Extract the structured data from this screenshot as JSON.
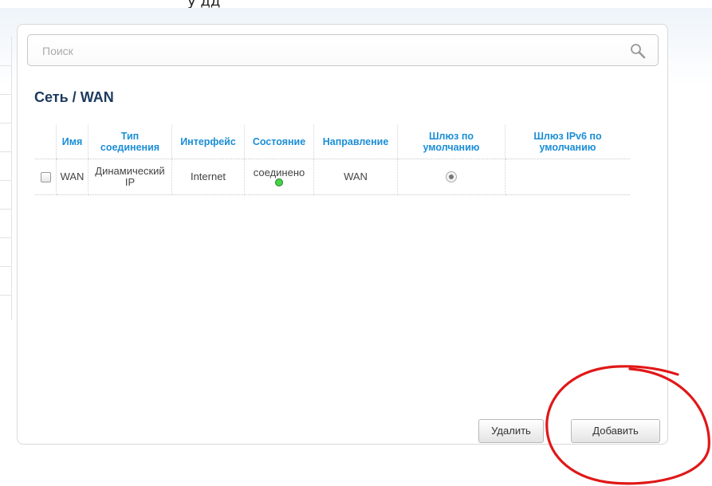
{
  "top_fragment": "у дд",
  "search": {
    "placeholder": "Поиск"
  },
  "breadcrumb": {
    "section": "Сеть",
    "separator": "/",
    "page": "WAN"
  },
  "table": {
    "headers": [
      "Имя",
      "Тип соединения",
      "Интерфейс",
      "Состояние",
      "Направление",
      "Шлюз по умолчанию",
      "Шлюз IPv6 по умолчанию"
    ],
    "rows": [
      {
        "checked": false,
        "name": "WAN",
        "type": "Динамический IP",
        "interface": "Internet",
        "status": "соединено",
        "status_color": "#45d445",
        "direction": "WAN",
        "default_gateway": true,
        "ipv6_gateway": ""
      }
    ]
  },
  "buttons": {
    "delete": "Удалить",
    "add": "Добавить"
  },
  "annotation": {
    "color": "#e01818",
    "shape": "circle-around-add-button"
  }
}
